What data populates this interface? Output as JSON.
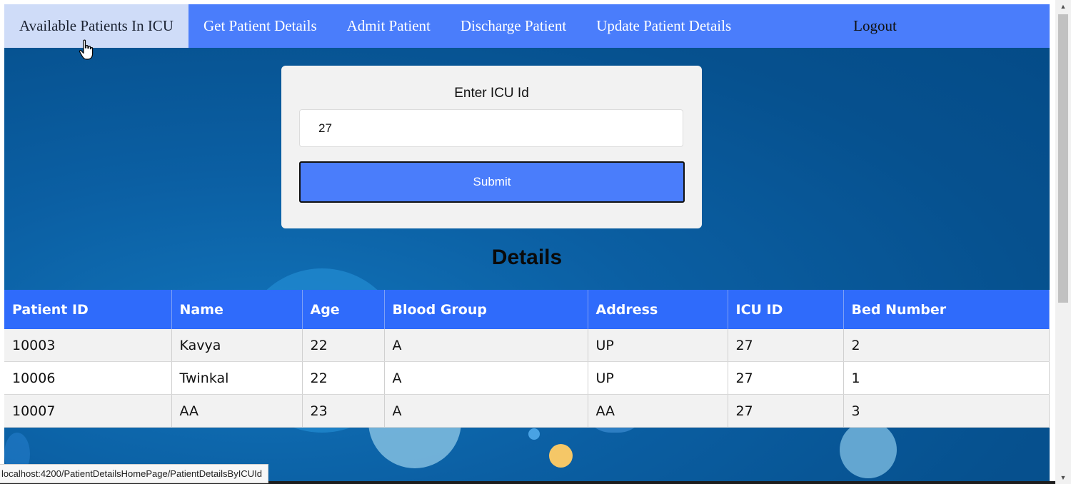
{
  "navbar": {
    "items": [
      {
        "label": "Available Patients In ICU",
        "active": true
      },
      {
        "label": "Get Patient Details"
      },
      {
        "label": "Admit Patient"
      },
      {
        "label": "Discharge Patient"
      },
      {
        "label": "Update Patient Details"
      }
    ],
    "logout_label": "Logout"
  },
  "form": {
    "label": "Enter ICU Id",
    "icu_id_value": "27",
    "submit_label": "Submit"
  },
  "details": {
    "heading": "Details",
    "columns": [
      "Patient ID",
      "Name",
      "Age",
      "Blood Group",
      "Address",
      "ICU ID",
      "Bed Number"
    ],
    "rows": [
      [
        "10003",
        "Kavya",
        "22",
        "A",
        "UP",
        "27",
        "2"
      ],
      [
        "10006",
        "Twinkal",
        "22",
        "A",
        "UP",
        "27",
        "1"
      ],
      [
        "10007",
        "AA",
        "23",
        "A",
        "AA",
        "27",
        "3"
      ]
    ]
  },
  "status_bar": {
    "url": "localhost:4200/PatientDetailsHomePage/PatientDetailsByICUId"
  },
  "colors": {
    "navbar": "#4a7dfb",
    "nav_active": "#cfdcf8",
    "table_header": "#2f6bfb",
    "background": "#06518f"
  },
  "icons": {
    "cursor": "hand-pointer-icon",
    "scroll_up": "triangle-up-icon",
    "scroll_down": "triangle-down-icon"
  }
}
